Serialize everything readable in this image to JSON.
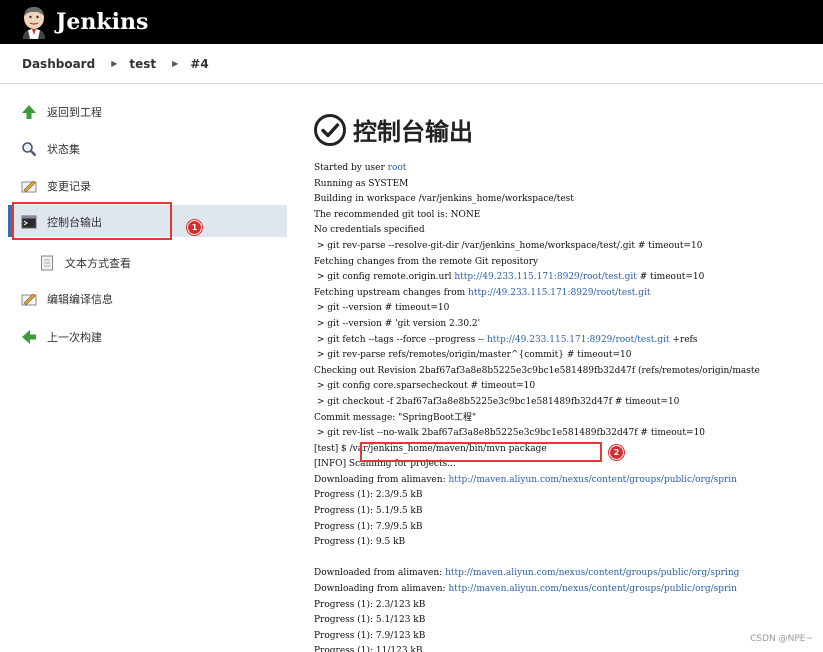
{
  "header": {
    "title": "Jenkins"
  },
  "breadcrumb": [
    "Dashboard",
    "test",
    "#4"
  ],
  "sidebar": {
    "items": [
      {
        "label": "返回到工程",
        "icon": "up-arrow-icon"
      },
      {
        "label": "状态集",
        "icon": "search-icon"
      },
      {
        "label": "变更记录",
        "icon": "notepad-icon"
      },
      {
        "label": "控制台输出",
        "icon": "terminal-icon",
        "active": true
      },
      {
        "label": "文本方式查看",
        "icon": "document-icon"
      },
      {
        "label": "编辑编译信息",
        "icon": "notepad-icon"
      },
      {
        "label": "上一次构建",
        "icon": "left-arrow-icon"
      }
    ]
  },
  "annotations": {
    "badge1": "1",
    "badge2": "2"
  },
  "main": {
    "title": "控制台输出"
  },
  "console": {
    "lines": [
      [
        {
          "t": "Started by user "
        },
        {
          "t": "root",
          "link": true
        }
      ],
      [
        {
          "t": "Running as SYSTEM"
        }
      ],
      [
        {
          "t": "Building in workspace /var/jenkins_home/workspace/test"
        }
      ],
      [
        {
          "t": "The recommended git tool is: NONE"
        }
      ],
      [
        {
          "t": "No credentials specified"
        }
      ],
      [
        {
          "t": " > git rev-parse --resolve-git-dir /var/jenkins_home/workspace/test/.git # timeout=10"
        }
      ],
      [
        {
          "t": "Fetching changes from the remote Git repository"
        }
      ],
      [
        {
          "t": " > git config remote.origin.url "
        },
        {
          "t": "http://49.233.115.171:8929/root/test.git",
          "link": true
        },
        {
          "t": " # timeout=10"
        }
      ],
      [
        {
          "t": "Fetching upstream changes from "
        },
        {
          "t": "http://49.233.115.171:8929/root/test.git",
          "link": true
        }
      ],
      [
        {
          "t": " > git --version # timeout=10"
        }
      ],
      [
        {
          "t": " > git --version # 'git version 2.30.2'"
        }
      ],
      [
        {
          "t": " > git fetch --tags --force --progress -- "
        },
        {
          "t": "http://49.233.115.171:8929/root/test.git",
          "link": true
        },
        {
          "t": " +refs"
        }
      ],
      [
        {
          "t": " > git rev-parse refs/remotes/origin/master^{commit} # timeout=10"
        }
      ],
      [
        {
          "t": "Checking out Revision 2baf67af3a8e8b5225e3c9bc1e581489fb32d47f (refs/remotes/origin/maste"
        }
      ],
      [
        {
          "t": " > git config core.sparsecheckout # timeout=10"
        }
      ],
      [
        {
          "t": " > git checkout -f 2baf67af3a8e8b5225e3c9bc1e581489fb32d47f # timeout=10"
        }
      ],
      [
        {
          "t": "Commit message: \"SpringBoot工程\""
        }
      ],
      [
        {
          "t": " > git rev-list --no-walk 2baf67af3a8e8b5225e3c9bc1e581489fb32d47f # timeout=10"
        }
      ],
      [
        {
          "t": "[test] $ /var/jenkins_home/maven/bin/mvn package"
        }
      ],
      [
        {
          "t": "[INFO] Scanning for projects..."
        }
      ],
      [
        {
          "t": "Downloading from alimaven: "
        },
        {
          "t": "http://maven.aliyun.com/nexus/content/groups/public/org/sprin",
          "link": true
        }
      ],
      [
        {
          "t": "Progress (1): 2.3/9.5 kB"
        }
      ],
      [
        {
          "t": "Progress (1): 5.1/9.5 kB"
        }
      ],
      [
        {
          "t": "Progress (1): 7.9/9.5 kB"
        }
      ],
      [
        {
          "t": "Progress (1): 9.5 kB"
        }
      ],
      [
        {
          "t": ""
        }
      ],
      [
        {
          "t": "Downloaded from alimaven: "
        },
        {
          "t": "http://maven.aliyun.com/nexus/content/groups/public/org/spring",
          "link": true
        }
      ],
      [
        {
          "t": "Downloading from alimaven: "
        },
        {
          "t": "http://maven.aliyun.com/nexus/content/groups/public/org/sprin",
          "link": true
        }
      ],
      [
        {
          "t": "Progress (1): 2.3/123 kB"
        }
      ],
      [
        {
          "t": "Progress (1): 5.1/123 kB"
        }
      ],
      [
        {
          "t": "Progress (1): 7.9/123 kB"
        }
      ],
      [
        {
          "t": "Progress (1): 11/123 kB"
        }
      ]
    ]
  },
  "watermark": "CSDN @NPE~",
  "colors": {
    "header_bg": "#000000",
    "link": "#2c5fa8",
    "annotation": "#e53935",
    "active_bg": "#e0e6ee"
  }
}
